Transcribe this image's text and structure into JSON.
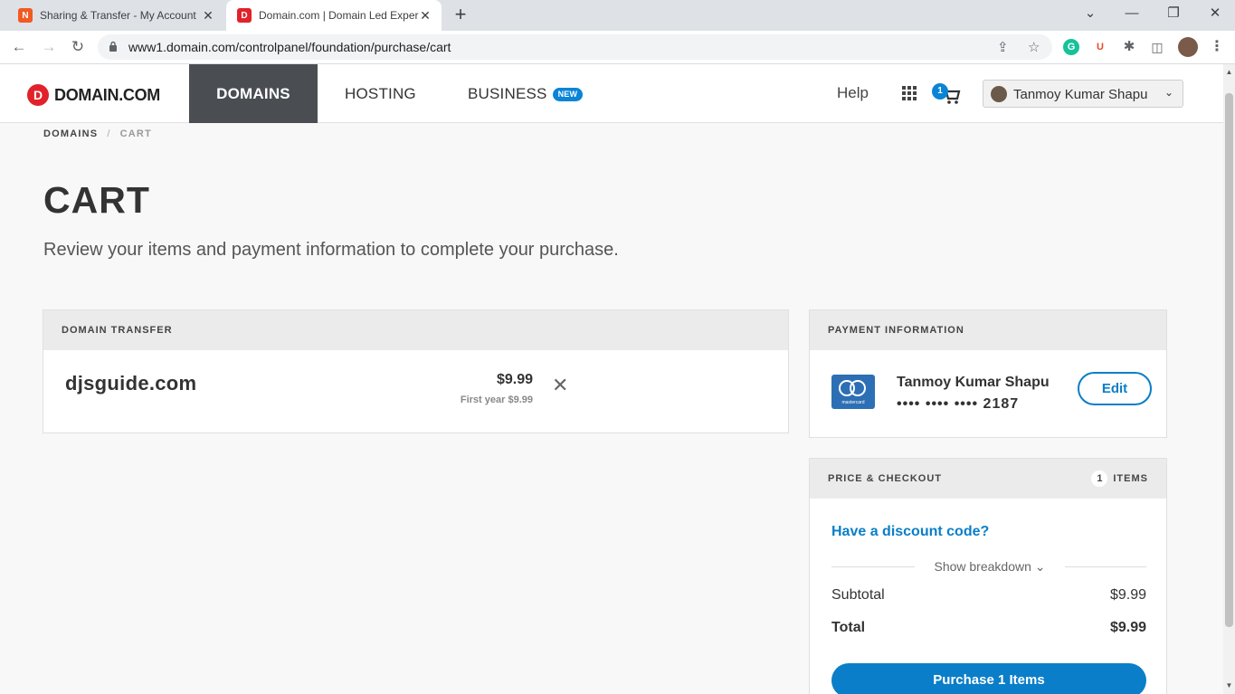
{
  "browser": {
    "tabs": [
      {
        "title": "Sharing & Transfer - My Account",
        "favicon_color": "#f15a22",
        "active": false
      },
      {
        "title": "Domain.com | Domain Led Exper",
        "favicon_color": "#e1222b",
        "active": true
      }
    ],
    "url": "www1.domain.com/controlpanel/foundation/purchase/cart"
  },
  "header": {
    "logo_text": "DOMAIN.COM",
    "nav": [
      "DOMAINS",
      "HOSTING",
      "BUSINESS"
    ],
    "new_badge": "NEW",
    "help": "Help",
    "cart_count": "1",
    "user_name": "Tanmoy Kumar Shapu"
  },
  "breadcrumb": [
    "DOMAINS",
    "CART"
  ],
  "page": {
    "title": "CART",
    "subtitle": "Review your items and payment information to complete your purchase."
  },
  "transfer": {
    "heading": "DOMAIN TRANSFER",
    "domain": "djsguide.com",
    "price": "$9.99",
    "price_note": "First year $9.99"
  },
  "payment": {
    "heading": "PAYMENT INFORMATION",
    "card_brand": "mastercard",
    "holder": "Tanmoy Kumar Shapu",
    "card_number": "•••• •••• •••• 2187",
    "edit": "Edit"
  },
  "checkout": {
    "heading": "PRICE & CHECKOUT",
    "item_count": "1",
    "items_label": "ITEMS",
    "discount": "Have a discount code?",
    "breakdown": "Show breakdown",
    "subtotal_label": "Subtotal",
    "subtotal": "$9.99",
    "total_label": "Total",
    "total": "$9.99",
    "purchase": "Purchase 1 Items"
  },
  "colors": {
    "accent": "#0a7ec8",
    "nav_active": "#4a4e52",
    "brand_red": "#e1222b"
  }
}
